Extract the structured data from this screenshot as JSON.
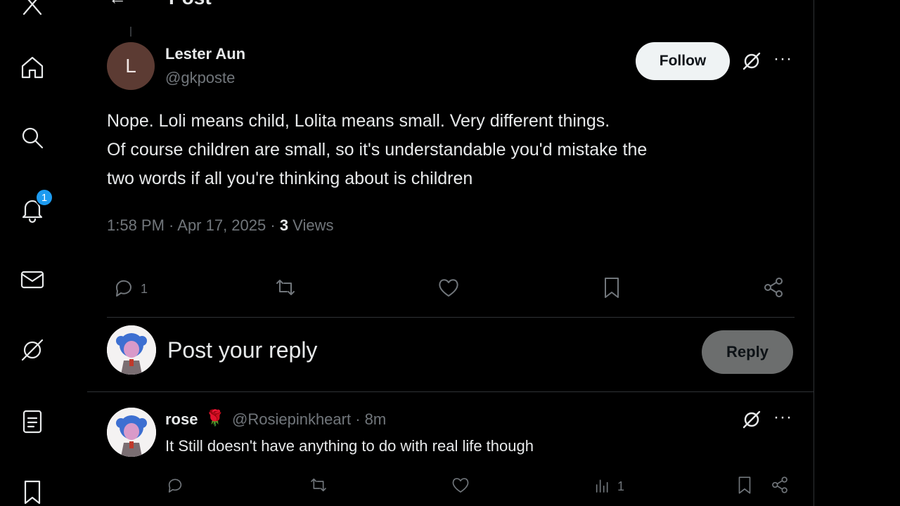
{
  "nav": {
    "items": [
      {
        "name": "x-logo-icon"
      },
      {
        "name": "home-icon"
      },
      {
        "name": "search-icon"
      },
      {
        "name": "notifications-icon"
      },
      {
        "name": "messages-icon"
      },
      {
        "name": "grok-icon"
      },
      {
        "name": "lists-icon"
      },
      {
        "name": "bookmarks-icon"
      }
    ],
    "notification_count": "1"
  },
  "header": {
    "back_label": "←",
    "title": "Post"
  },
  "post": {
    "avatar_letter": "L",
    "author_name": "Lester Aun",
    "author_handle": "@gkposte",
    "follow_label": "Follow",
    "more_label": "···",
    "body_line1": "Nope. Loli means child, Lolita means small. Very different things.",
    "body_line2": "Of course children are small, so it's understandable you'd mistake the",
    "body_line3": "two words if all you're thinking about is children",
    "time": "1:58 PM · Apr 17, 2025 · ",
    "views_count": "3",
    "views_label": " Views",
    "reply_count": "1"
  },
  "composer": {
    "placeholder": "Post your reply",
    "reply_label": "Reply"
  },
  "reply": {
    "name": "rose",
    "rose_emoji": "🌹",
    "handle_time": "@Rosiepinkheart · 8m",
    "text": "It  Still doesn't have anything to do with real life  though",
    "more_label": "···",
    "views_count": "1"
  },
  "colors": {
    "background": "#000000",
    "text": "#e7e9ea",
    "muted": "#71767b",
    "accent": "#1d9bf0",
    "divider": "#2f3336"
  }
}
